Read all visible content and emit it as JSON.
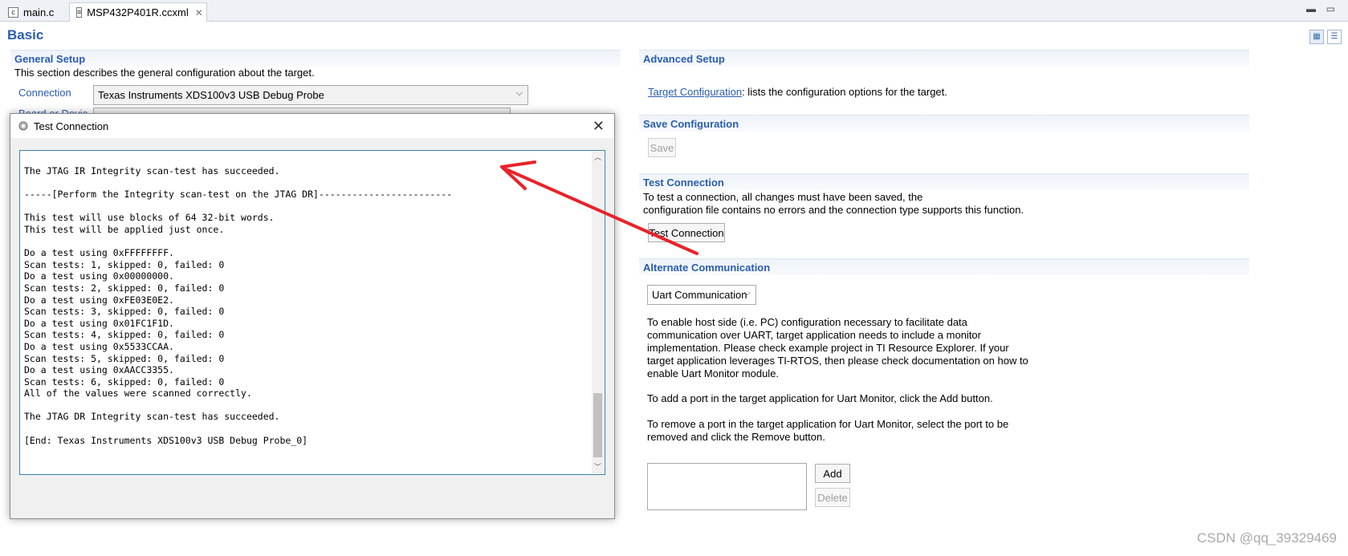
{
  "tabs": [
    {
      "label": "main.c",
      "icon": "c-file-icon"
    },
    {
      "label": "MSP432P401R.ccxml",
      "icon": "ccxml-file-icon"
    }
  ],
  "page": {
    "title": "Basic"
  },
  "general": {
    "title": "General Setup",
    "desc": "This section describes the general configuration about the target.",
    "connection_label": "Connection",
    "connection_value": "Texas Instruments XDS100v3 USB Debug Probe",
    "board_label_partial": "Board or Devic"
  },
  "advanced": {
    "title": "Advanced Setup",
    "link": "Target Configuration",
    "desc": ": lists the configuration options for the target."
  },
  "save": {
    "title": "Save Configuration",
    "button": "Save"
  },
  "test": {
    "title": "Test Connection",
    "desc1": "To test a connection, all changes must have been saved, the",
    "desc2": "configuration file contains no errors and the connection type supports this function.",
    "button": "Test Connection"
  },
  "alternate": {
    "title": "Alternate Communication",
    "combo_value": "Uart Communication",
    "para1": [
      "To enable host side (i.e. PC) configuration necessary to facilitate data",
      "communication over UART, target application needs to include a monitor",
      "implementation. Please check example project in TI Resource Explorer. If your",
      "target application leverages TI-RTOS, then please check documentation on how to",
      "enable Uart Monitor module."
    ],
    "para2": "To add a port in the target application for Uart Monitor, click the Add button.",
    "para3": [
      "To remove a port in the target application for Uart Monitor, select the port to be",
      "removed and click the Remove button."
    ],
    "add_button": "Add",
    "delete_button": "Delete"
  },
  "dialog": {
    "title": "Test Connection",
    "lines": [
      "The JTAG IR Integrity scan-test has succeeded.",
      "",
      "-----[Perform the Integrity scan-test on the JTAG DR]------------------------",
      "",
      "This test will use blocks of 64 32-bit words.",
      "This test will be applied just once.",
      "",
      "Do a test using 0xFFFFFFFF.",
      "Scan tests: 1, skipped: 0, failed: 0",
      "Do a test using 0x00000000.",
      "Scan tests: 2, skipped: 0, failed: 0",
      "Do a test using 0xFE03E0E2.",
      "Scan tests: 3, skipped: 0, failed: 0",
      "Do a test using 0x01FC1F1D.",
      "Scan tests: 4, skipped: 0, failed: 0",
      "Do a test using 0x5533CCAA.",
      "Scan tests: 5, skipped: 0, failed: 0",
      "Do a test using 0xAACC3355.",
      "Scan tests: 6, skipped: 0, failed: 0",
      "All of the values were scanned correctly.",
      "",
      "The JTAG DR Integrity scan-test has succeeded.",
      "",
      "[End: Texas Instruments XDS100v3 USB Debug Probe_0]"
    ]
  },
  "watermark": "CSDN @qq_39329469",
  "colors": {
    "accent": "#2a5db0",
    "annotation_arrow": "#e8232a"
  }
}
